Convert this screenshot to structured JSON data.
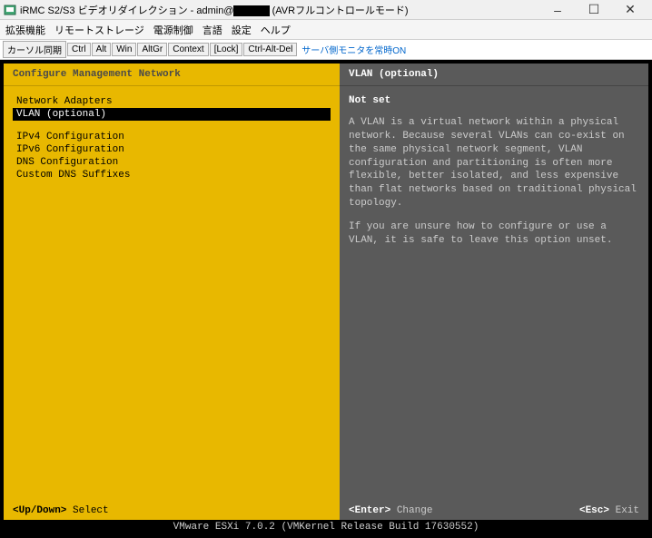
{
  "window": {
    "title_prefix": "iRMC S2/S3 ビデオリダイレクション - admin@",
    "title_suffix": "(AVRフルコントロールモード)",
    "minimize": "–",
    "maximize": "☐",
    "close": "✕"
  },
  "menubar": {
    "items": [
      "拡張機能",
      "リモートストレージ",
      "電源制御",
      "言語",
      "設定",
      "ヘルプ"
    ]
  },
  "toolbar": {
    "buttons": [
      "カーソル同期",
      "Ctrl",
      "Alt",
      "Win",
      "AltGr",
      "Context",
      "[Lock]",
      "Ctrl-Alt-Del"
    ],
    "status": "サーバ側モニタを常時ON"
  },
  "left": {
    "header": "Configure Management Network",
    "items": [
      {
        "label": "Network Adapters",
        "selected": false
      },
      {
        "label": "VLAN (optional)",
        "selected": true
      }
    ],
    "items2": [
      {
        "label": "IPv4 Configuration"
      },
      {
        "label": "IPv6 Configuration"
      },
      {
        "label": "DNS Configuration"
      },
      {
        "label": "Custom DNS Suffixes"
      }
    ]
  },
  "right": {
    "header": "VLAN (optional)",
    "status": "Not set",
    "para1": "A VLAN is a virtual network within a physical network. Because several VLANs can co-exist on the same physical network segment, VLAN configuration and partitioning is often more flexible, better isolated, and less expensive than flat networks based on traditional physical topology.",
    "para2": "If you are unsure how to configure or use a VLAN, it is safe to leave this option unset."
  },
  "hints": {
    "updown_key": "<Up/Down>",
    "updown_action": "Select",
    "enter_key": "<Enter>",
    "enter_action": "Change",
    "esc_key": "<Esc>",
    "esc_action": "Exit"
  },
  "statusbar": "VMware ESXi 7.0.2 (VMKernel Release Build 17630552)"
}
